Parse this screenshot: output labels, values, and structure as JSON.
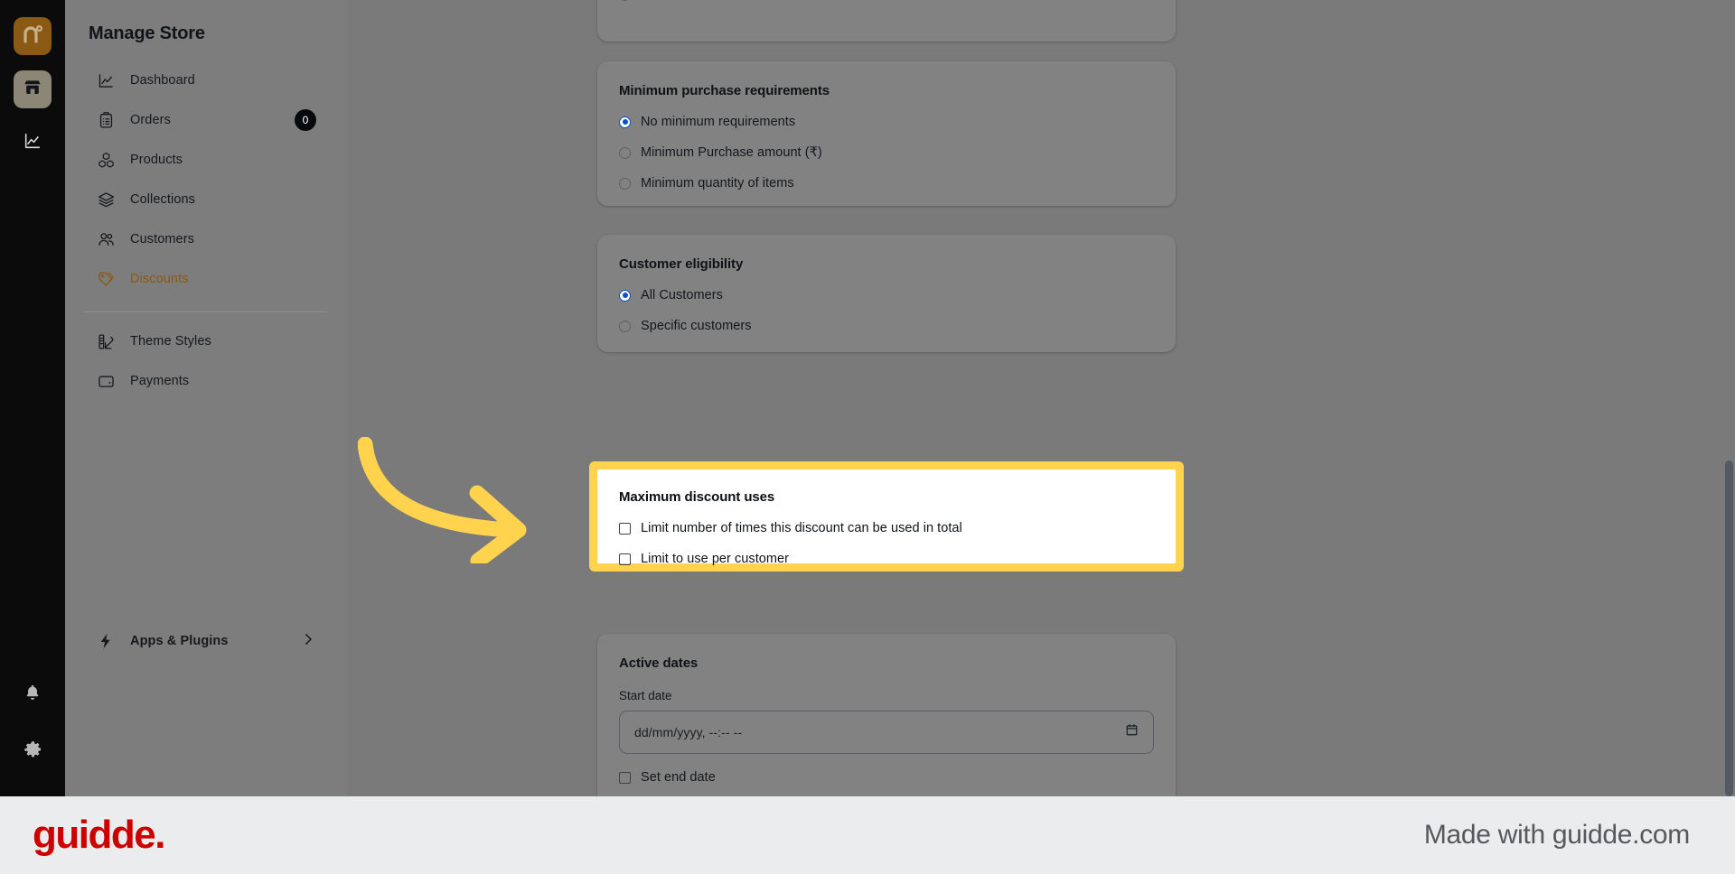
{
  "rail": {
    "items": [
      {
        "name": "brand-logo",
        "icon": "n-logo-icon",
        "active": true
      },
      {
        "name": "store",
        "icon": "store-icon",
        "active": true
      },
      {
        "name": "analytics",
        "icon": "analytics-icon",
        "active": false
      }
    ],
    "bottom": [
      {
        "name": "notifications",
        "icon": "bell-icon"
      },
      {
        "name": "settings",
        "icon": "gear-icon"
      }
    ]
  },
  "sidebar": {
    "title": "Manage Store",
    "items": [
      {
        "label": "Dashboard",
        "icon": "chart-line-icon",
        "badge": null,
        "active": false
      },
      {
        "label": "Orders",
        "icon": "clipboard-icon",
        "badge": "0",
        "active": false
      },
      {
        "label": "Products",
        "icon": "boxes-icon",
        "badge": null,
        "active": false
      },
      {
        "label": "Collections",
        "icon": "layers-icon",
        "badge": null,
        "active": false
      },
      {
        "label": "Customers",
        "icon": "users-icon",
        "badge": null,
        "active": false
      },
      {
        "label": "Discounts",
        "icon": "tag-icon",
        "badge": null,
        "active": true
      }
    ],
    "secondary_items": [
      {
        "label": "Theme Styles",
        "icon": "palette-icon"
      },
      {
        "label": "Payments",
        "icon": "wallet-icon"
      }
    ],
    "apps_plugins": {
      "label": "Apps & Plugins",
      "icon": "lightning-icon",
      "chevron": "chevron-right-icon"
    },
    "active_color": "#8a5a14"
  },
  "main": {
    "minimum_purchase": {
      "title": "Minimum purchase requirements",
      "options": [
        {
          "label": "No minimum requirements",
          "checked": true
        },
        {
          "label": "Minimum Purchase amount (₹)",
          "checked": false
        },
        {
          "label": "Minimum quantity of items",
          "checked": false
        }
      ]
    },
    "customer_eligibility": {
      "title": "Customer eligibility",
      "options": [
        {
          "label": "All Customers",
          "checked": true
        },
        {
          "label": "Specific customers",
          "checked": false
        }
      ]
    },
    "maximum_discount_uses": {
      "title": "Maximum discount uses",
      "highlighted": true,
      "highlight_color": "#ffd34d",
      "options": [
        {
          "label": "Limit number of times this discount can be used in total",
          "checked": false
        },
        {
          "label": "Limit to use per customer",
          "checked": false
        }
      ]
    },
    "active_dates": {
      "title": "Active dates",
      "start_date_label": "Start date",
      "start_date_placeholder": "dd/mm/yyyy, --:-- --",
      "start_date_value": "dd/mm/yyyy, --:-- --",
      "calendar_icon": "calendar-icon",
      "set_end_date_label": "Set end date",
      "set_end_date_checked": false
    }
  },
  "annotation": {
    "arrow": "curved-arrow-icon",
    "arrow_color": "#ffd34d"
  },
  "bottom_bar": {
    "logo_text": "guidde.",
    "logo_color": "#cc0000",
    "made_with": "Made with guidde.com"
  }
}
